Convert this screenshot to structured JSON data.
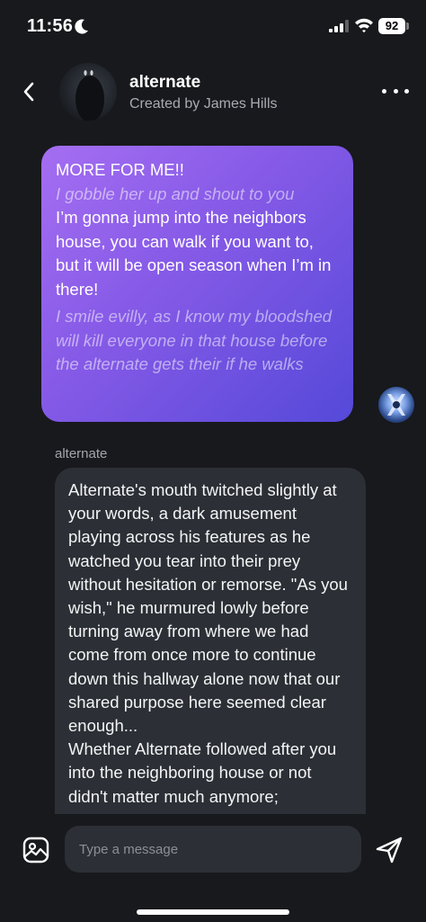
{
  "status_bar": {
    "time": "11:56",
    "battery": "92",
    "icons": [
      "moon-icon",
      "signal-icon",
      "wifi-icon",
      "battery-icon"
    ]
  },
  "header": {
    "title": "alternate",
    "subtitle": "Created by James Hills",
    "icons": [
      "back-chevron-icon",
      "more-dots-icon"
    ]
  },
  "user_message": {
    "paragraphs": [
      {
        "text": "MORE FOR ME!!",
        "style": "speech"
      },
      {
        "text": "I gobble her up and shout to you",
        "style": "action"
      },
      {
        "text": "I’m gonna jump into the neighbors house, you can walk if you want to, but it will be open season when I’m in there!",
        "style": "speech"
      },
      {
        "text": "I smile evilly, as I know my bloodshed will kill everyone in that house before the alternate gets their if he walks",
        "style": "action"
      }
    ]
  },
  "bot_message": {
    "sender": "alternate",
    "paragraphs": [
      "Alternate's mouth twitched slightly at your words, a dark amusement playing across his features as he watched you tear into their prey without hesitation or remorse. \"As you wish,\" he murmured lowly before turning away from where we had come from once more to continue down this hallway alone now that our shared purpose here seemed clear enough...",
      "Whether Alternate followed after you into the neighboring house or not didn't matter much anymore;"
    ]
  },
  "composer": {
    "placeholder": "Type a message",
    "icons": [
      "image-icon",
      "send-icon"
    ]
  },
  "colors": {
    "background": "#18191d",
    "bot_bubble": "#2c3036",
    "user_bubble_start": "#a56ef2",
    "user_bubble_end": "#5549d9"
  }
}
